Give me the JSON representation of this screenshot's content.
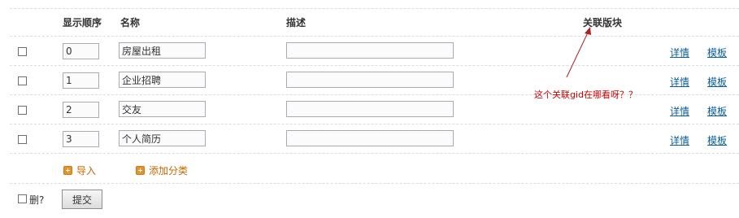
{
  "headers": {
    "order": "显示顺序",
    "name": "名称",
    "desc": "描述",
    "related": "关联版块"
  },
  "rows": [
    {
      "order": "0",
      "name": "房屋出租",
      "desc": "",
      "detail": "详情",
      "template": "模板"
    },
    {
      "order": "1",
      "name": "企业招聘",
      "desc": "",
      "detail": "详情",
      "template": "模板"
    },
    {
      "order": "2",
      "name": "交友",
      "desc": "",
      "detail": "详情",
      "template": "模板"
    },
    {
      "order": "3",
      "name": "个人简历",
      "desc": "",
      "detail": "详情",
      "template": "模板"
    }
  ],
  "actions": {
    "import": "导入",
    "add_category": "添加分类"
  },
  "footer": {
    "delete_label": "删?",
    "submit": "提交"
  },
  "annotation": {
    "text": "这个关联gid在哪看呀？？",
    "color": "#cc0000"
  },
  "colors": {
    "link": "#0a5e98",
    "add_icon": "#e8932a",
    "add_text": "#c56a00"
  }
}
